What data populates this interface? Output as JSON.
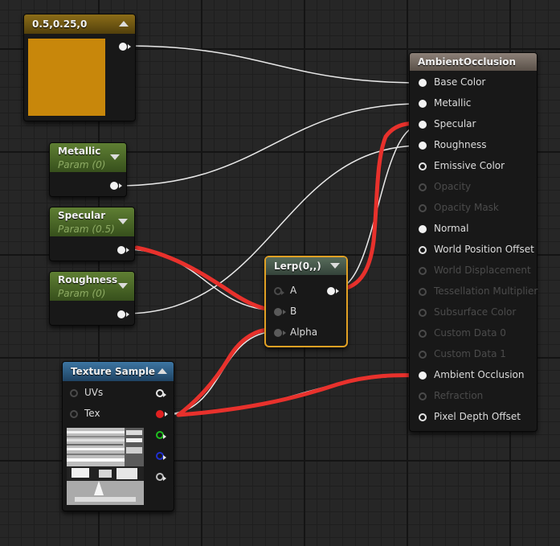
{
  "constant_node": {
    "title": "0.5,0.25,0",
    "swatch_color": "#c8870b"
  },
  "param_nodes": {
    "metallic": {
      "title": "Metallic",
      "sub": "Param (0)"
    },
    "specular": {
      "title": "Specular",
      "sub": "Param (0.5)"
    },
    "roughness": {
      "title": "Roughness",
      "sub": "Param (0)"
    }
  },
  "lerp_node": {
    "title": "Lerp(0,,)",
    "pins": {
      "a": "A",
      "b": "B",
      "alpha": "Alpha"
    }
  },
  "texture_node": {
    "title": "Texture Sample",
    "pins": {
      "uvs": "UVs",
      "tex": "Tex"
    }
  },
  "material_node": {
    "title": "AmbientOcclusion",
    "pins": [
      {
        "label": "Base Color",
        "enabled": true,
        "connected": true
      },
      {
        "label": "Metallic",
        "enabled": true,
        "connected": true
      },
      {
        "label": "Specular",
        "enabled": true,
        "connected": true
      },
      {
        "label": "Roughness",
        "enabled": true,
        "connected": true
      },
      {
        "label": "Emissive Color",
        "enabled": true,
        "connected": false
      },
      {
        "label": "Opacity",
        "enabled": false,
        "connected": false
      },
      {
        "label": "Opacity Mask",
        "enabled": false,
        "connected": false
      },
      {
        "label": "Normal",
        "enabled": true,
        "connected": true
      },
      {
        "label": "World Position Offset",
        "enabled": true,
        "connected": false
      },
      {
        "label": "World Displacement",
        "enabled": false,
        "connected": false
      },
      {
        "label": "Tessellation Multiplier",
        "enabled": false,
        "connected": false
      },
      {
        "label": "Subsurface Color",
        "enabled": false,
        "connected": false
      },
      {
        "label": "Custom Data 0",
        "enabled": false,
        "connected": false
      },
      {
        "label": "Custom Data 1",
        "enabled": false,
        "connected": false
      },
      {
        "label": "Ambient Occlusion",
        "enabled": true,
        "connected": true
      },
      {
        "label": "Refraction",
        "enabled": false,
        "connected": false
      },
      {
        "label": "Pixel Depth Offset",
        "enabled": true,
        "connected": false
      }
    ]
  },
  "colors": {
    "red_annotation": "#e8312c",
    "wire_white": "#e8e8e8",
    "lerp_border": "#e0a024",
    "param_header_green": "#4f6e2a",
    "texture_header_blue": "#2f5f86",
    "material_header": "#7a6e64"
  }
}
